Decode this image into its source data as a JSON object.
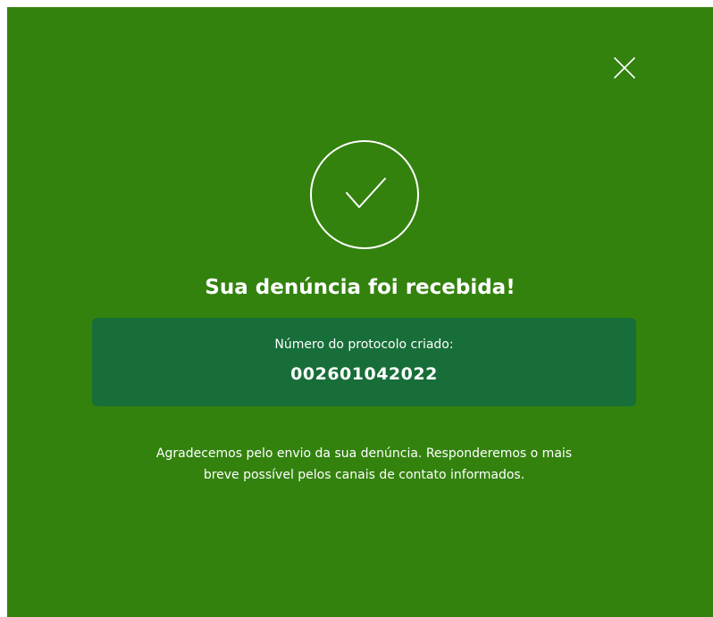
{
  "modal": {
    "title": "Sua denúncia foi recebida!",
    "protocol_label": "Número do protocolo criado:",
    "protocol_number": "002601042022",
    "message_line1": "Agradecemos pelo envio da sua denúncia. Responderemos o mais",
    "message_line2": "breve possível pelos canais de contato informados.",
    "close_icon": "close-icon",
    "success_icon": "check-circle-icon"
  },
  "colors": {
    "background": "#33820e",
    "protocol_box": "#176e38",
    "text": "#ffffff"
  }
}
